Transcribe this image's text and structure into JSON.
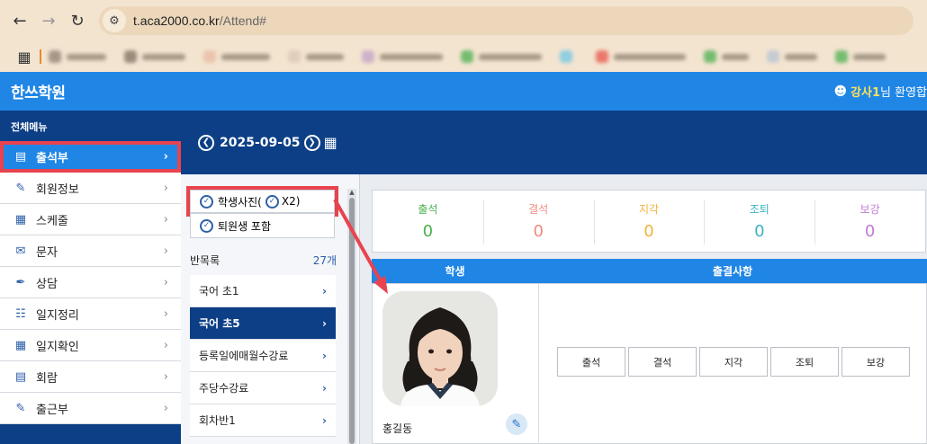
{
  "browser": {
    "url_host": "t.aca2000.co.kr",
    "url_path": "/Attend#"
  },
  "header": {
    "title": "한쓰학원",
    "user_name": "강사1",
    "greeting": "님 환영합"
  },
  "sidebar": {
    "title": "전체메뉴",
    "items": [
      {
        "label": "출석부",
        "icon": "attendance-book-icon"
      },
      {
        "label": "회원정보",
        "icon": "member-info-icon"
      },
      {
        "label": "스케줄",
        "icon": "schedule-icon"
      },
      {
        "label": "문자",
        "icon": "mail-icon"
      },
      {
        "label": "상담",
        "icon": "pen-icon"
      },
      {
        "label": "일지정리",
        "icon": "journal-icon"
      },
      {
        "label": "일지확인",
        "icon": "calendar-check-icon"
      },
      {
        "label": "회람",
        "icon": "message-icon"
      },
      {
        "label": "출근부",
        "icon": "checkin-icon"
      }
    ]
  },
  "date_nav": {
    "date": "2025-09-05"
  },
  "options": {
    "photo_label": "학생사진(",
    "photo_x2": "X2)",
    "withdrawn_label": "퇴원생 포함"
  },
  "classes": {
    "title": "반목록",
    "count": "27개",
    "items": [
      {
        "label": "국어 초1"
      },
      {
        "label": "국어 초5"
      },
      {
        "label": "등록일에매월수강료"
      },
      {
        "label": "주당수강료"
      },
      {
        "label": "회차반1"
      }
    ]
  },
  "stats": {
    "items": [
      {
        "label": "출석",
        "value": "0",
        "color": "#4caf50"
      },
      {
        "label": "결석",
        "value": "0",
        "color": "#ef8a80"
      },
      {
        "label": "지각",
        "value": "0",
        "color": "#f0b43a"
      },
      {
        "label": "조퇴",
        "value": "0",
        "color": "#3bb3c3"
      },
      {
        "label": "보강",
        "value": "0",
        "color": "#c07ad6"
      }
    ]
  },
  "table": {
    "col_student": "학생",
    "col_attendance": "출결사항"
  },
  "student": {
    "name": "홍길동"
  },
  "attend_buttons": [
    "출석",
    "결석",
    "지각",
    "조퇴",
    "보강"
  ],
  "colors": {
    "accent_blue": "#1f86e6",
    "navy": "#0d3f86",
    "highlight_red": "#e8434f"
  }
}
